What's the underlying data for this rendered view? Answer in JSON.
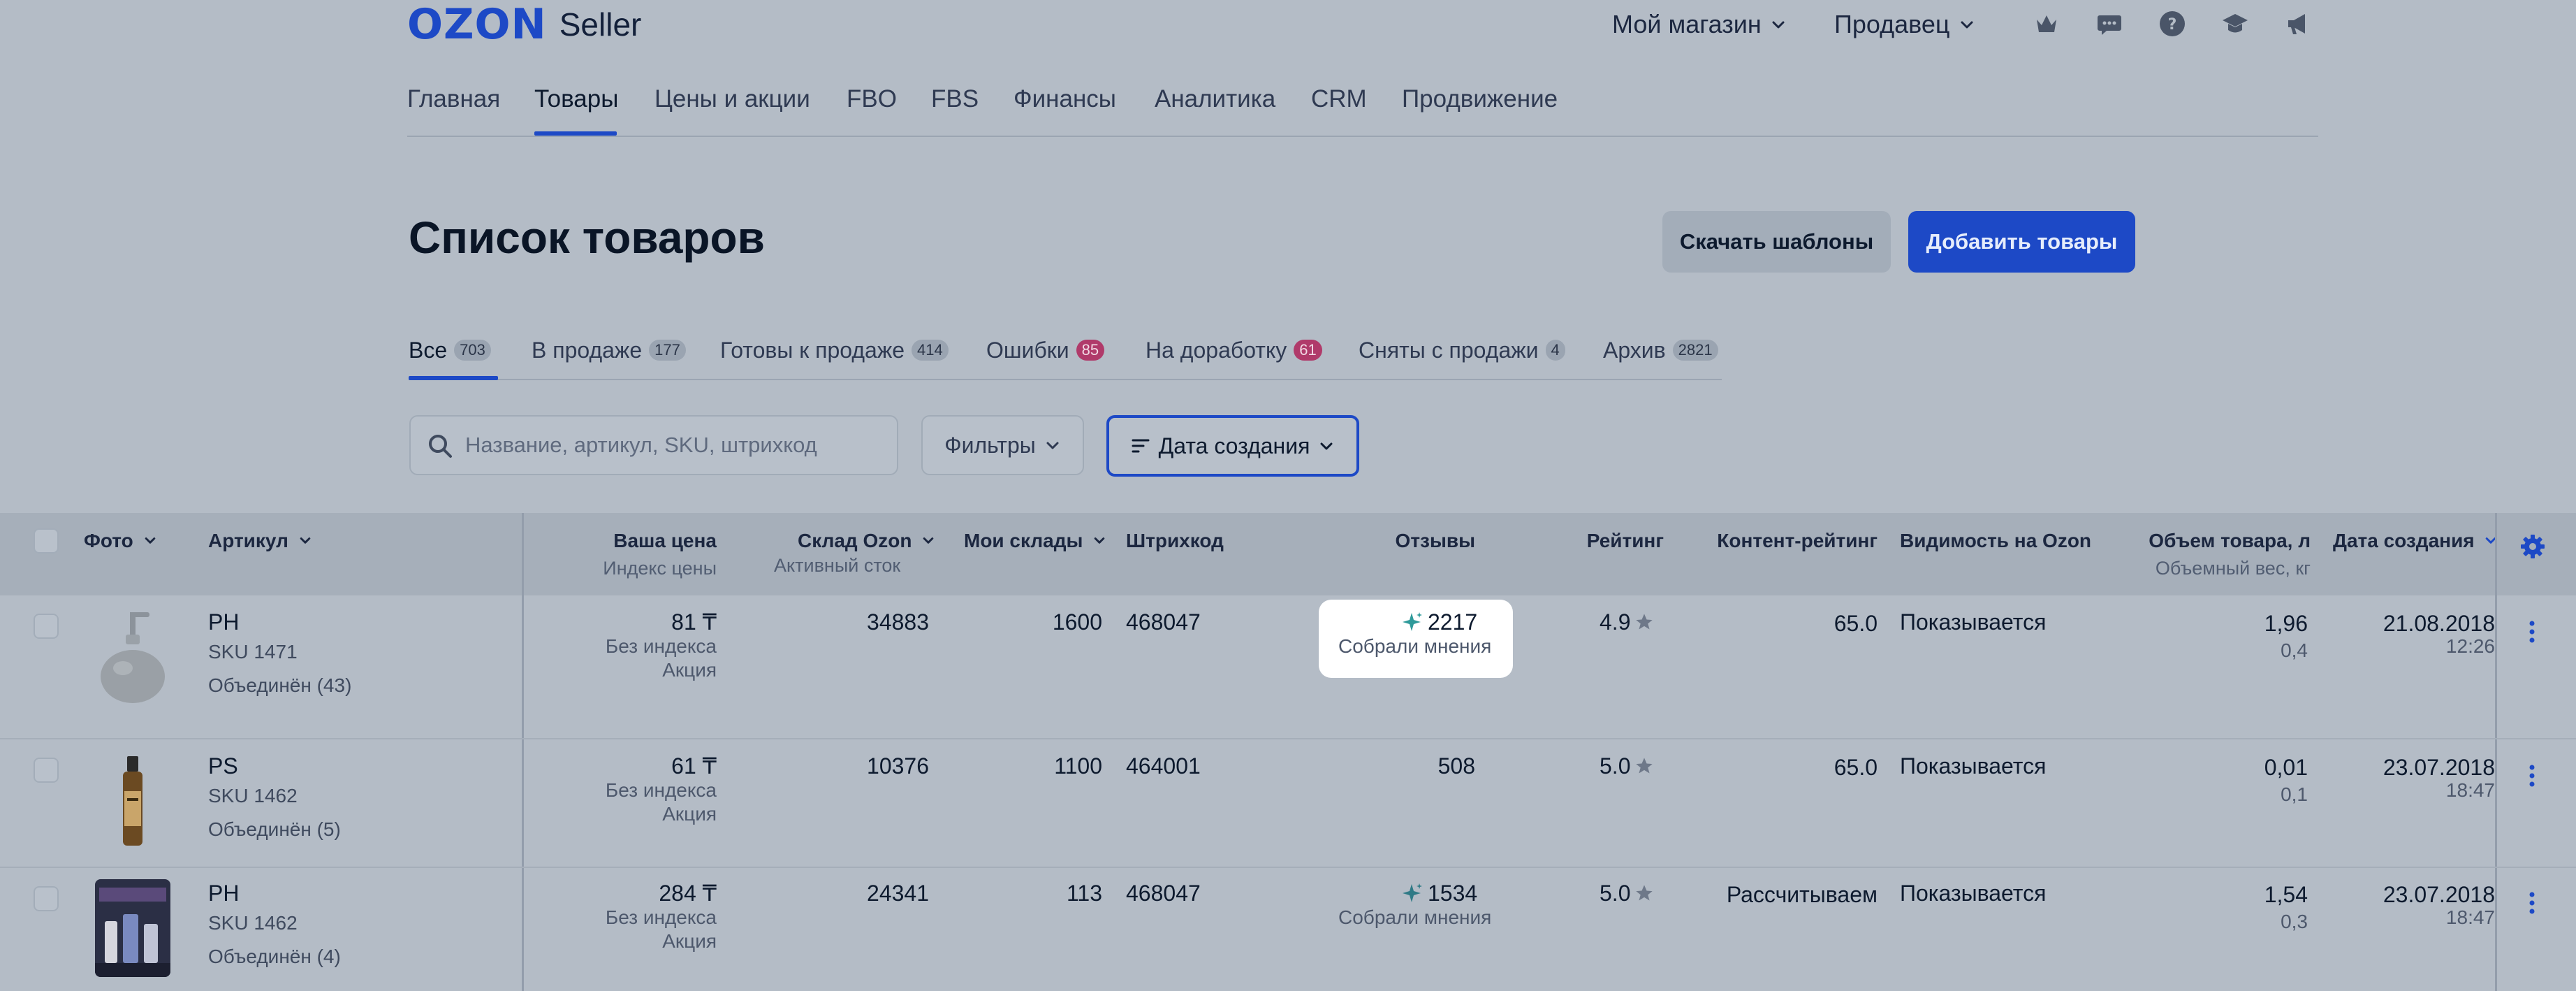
{
  "header": {
    "logo_brand": "OZON",
    "logo_product": "Seller",
    "store_menu": "Мой магазин",
    "seller_menu": "Продавец"
  },
  "nav": {
    "items": [
      "Главная",
      "Товары",
      "Цены и акции",
      "FBO",
      "FBS",
      "Финансы",
      "Аналитика",
      "CRM",
      "Продвижение"
    ],
    "active": "Товары"
  },
  "page": {
    "title": "Список товаров",
    "download_templates": "Скачать шаблоны",
    "add_products": "Добавить товары"
  },
  "tabs": [
    {
      "label": "Все",
      "count": "703"
    },
    {
      "label": "В продаже",
      "count": "177"
    },
    {
      "label": "Готовы к продаже",
      "count": "414"
    },
    {
      "label": "Ошибки",
      "count": "85"
    },
    {
      "label": "На доработку",
      "count": "61"
    },
    {
      "label": "Сняты с продажи",
      "count": "4"
    },
    {
      "label": "Архив",
      "count": "2821"
    }
  ],
  "filters": {
    "search_placeholder": "Название, артикул, SKU, штрихкод",
    "filters_label": "Фильтры",
    "sort_label": "Дата создания"
  },
  "columns": {
    "photo": "Фото",
    "article": "Артикул",
    "price": "Ваша цена",
    "price_sub": "Индекс цены",
    "ozon_stock": "Склад Ozon",
    "ozon_stock_sub": "Активный сток",
    "my_stock": "Мои склады",
    "barcode": "Штрихкод",
    "reviews": "Отзывы",
    "rating": "Рейтинг",
    "content_rating": "Контент-рейтинг",
    "visibility": "Видимость на Ozon",
    "volume": "Объем товара, л",
    "volume_sub": "Объемный вес, кг",
    "created": "Дата создания"
  },
  "rows": [
    {
      "article": "PH",
      "sku": "SKU 1471",
      "merged": "Объединён (43)",
      "price": "81 ₸",
      "price_index": "Без индекса",
      "promo": "Акция",
      "ozon_stock": "34883",
      "my_stock": "1600",
      "barcode": "468047",
      "reviews": "2217",
      "reviews_note": "Собрали мнения",
      "rating": "4.9",
      "content_rating": "65.0",
      "visibility": "Показывается",
      "volume": "1,96",
      "volume_weight": "0,4",
      "date": "21.08.2018",
      "time": "12:26"
    },
    {
      "article": "PS",
      "sku": "SKU 1462",
      "merged": "Объединён (5)",
      "price": "61 ₸",
      "price_index": "Без индекса",
      "promo": "Акция",
      "ozon_stock": "10376",
      "my_stock": "1100",
      "barcode": "464001",
      "reviews": "508",
      "reviews_note": "",
      "rating": "5.0",
      "content_rating": "65.0",
      "visibility": "Показывается",
      "volume": "0,01",
      "volume_weight": "0,1",
      "date": "23.07.2018",
      "time": "18:47"
    },
    {
      "article": "PH",
      "sku": "SKU 1462",
      "merged": "Объединён (4)",
      "price": "284 ₸",
      "price_index": "Без индекса",
      "promo": "Акция",
      "ozon_stock": "24341",
      "my_stock": "113",
      "barcode": "468047",
      "reviews": "1534",
      "reviews_note": "Собрали мнения",
      "rating": "5.0",
      "content_rating": "Рассчитываем",
      "visibility": "Показывается",
      "volume": "1,54",
      "volume_weight": "0,3",
      "date": "23.07.2018",
      "time": "18:47"
    }
  ]
}
